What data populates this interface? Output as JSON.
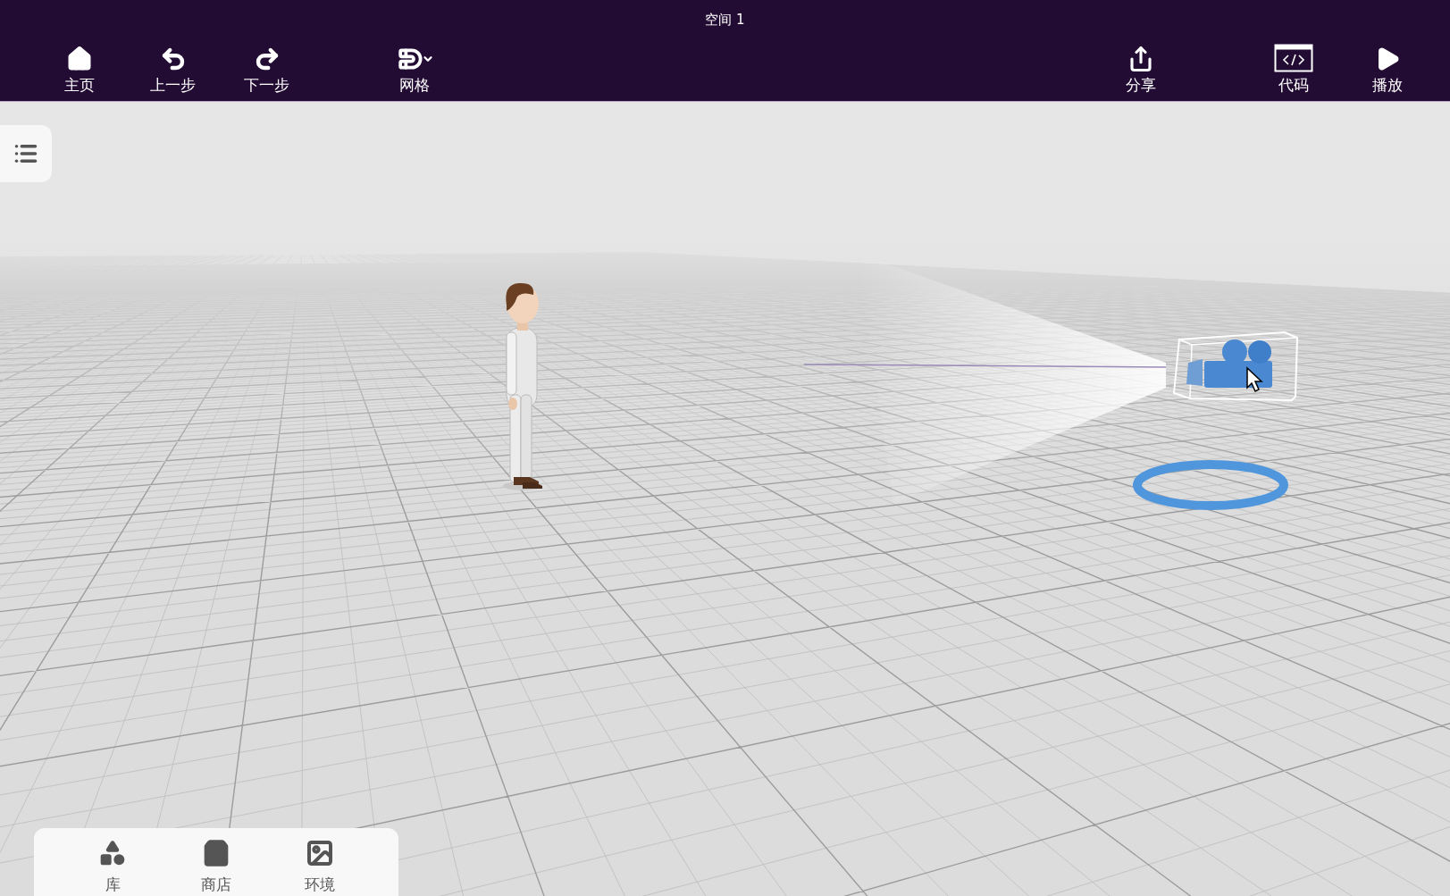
{
  "window": {
    "title": "空间 1"
  },
  "toolbar_left": [
    {
      "kind": "home",
      "label": "主页"
    },
    {
      "kind": "undo",
      "label": "上一步"
    },
    {
      "kind": "redo",
      "label": "下一步"
    },
    {
      "kind": "grid",
      "label": "网格"
    }
  ],
  "toolbar_right": [
    {
      "kind": "share",
      "label": "分享"
    },
    {
      "kind": "code",
      "label": "代码"
    },
    {
      "kind": "play",
      "label": "播放"
    }
  ],
  "bottom_tabs": [
    {
      "kind": "library",
      "label": "库"
    },
    {
      "kind": "store",
      "label": "商店"
    },
    {
      "kind": "environment",
      "label": "环境"
    }
  ]
}
